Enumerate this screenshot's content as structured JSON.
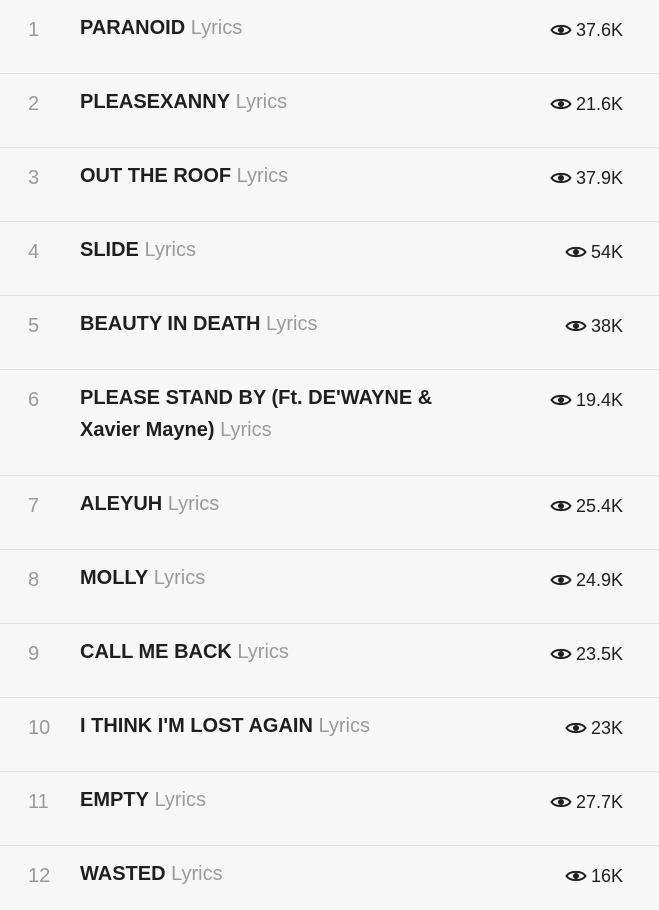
{
  "lyrics_suffix": "Lyrics",
  "tracks": [
    {
      "number": "1",
      "title": "PARANOID",
      "views": "37.6K"
    },
    {
      "number": "2",
      "title": "PLEASEXANNY",
      "views": "21.6K"
    },
    {
      "number": "3",
      "title": "OUT THE ROOF",
      "views": "37.9K"
    },
    {
      "number": "4",
      "title": "SLIDE",
      "views": "54K"
    },
    {
      "number": "5",
      "title": "BEAUTY IN DEATH",
      "views": "38K"
    },
    {
      "number": "6",
      "title": "PLEASE STAND BY (Ft. DE'WAYNE & Xavier Mayne)",
      "views": "19.4K"
    },
    {
      "number": "7",
      "title": "ALEYUH",
      "views": "25.4K"
    },
    {
      "number": "8",
      "title": "MOLLY",
      "views": "24.9K"
    },
    {
      "number": "9",
      "title": "CALL ME BACK",
      "views": "23.5K"
    },
    {
      "number": "10",
      "title": "I THINK I'M LOST AGAIN",
      "views": "23K"
    },
    {
      "number": "11",
      "title": "EMPTY",
      "views": "27.7K"
    },
    {
      "number": "12",
      "title": "WASTED",
      "views": "16K"
    }
  ],
  "icons": {
    "views": "eye-icon"
  },
  "colors": {
    "background": "#f7f7f7",
    "title": "#1f1f1f",
    "muted": "#9b9b9b",
    "divider": "#e2e2e2"
  }
}
